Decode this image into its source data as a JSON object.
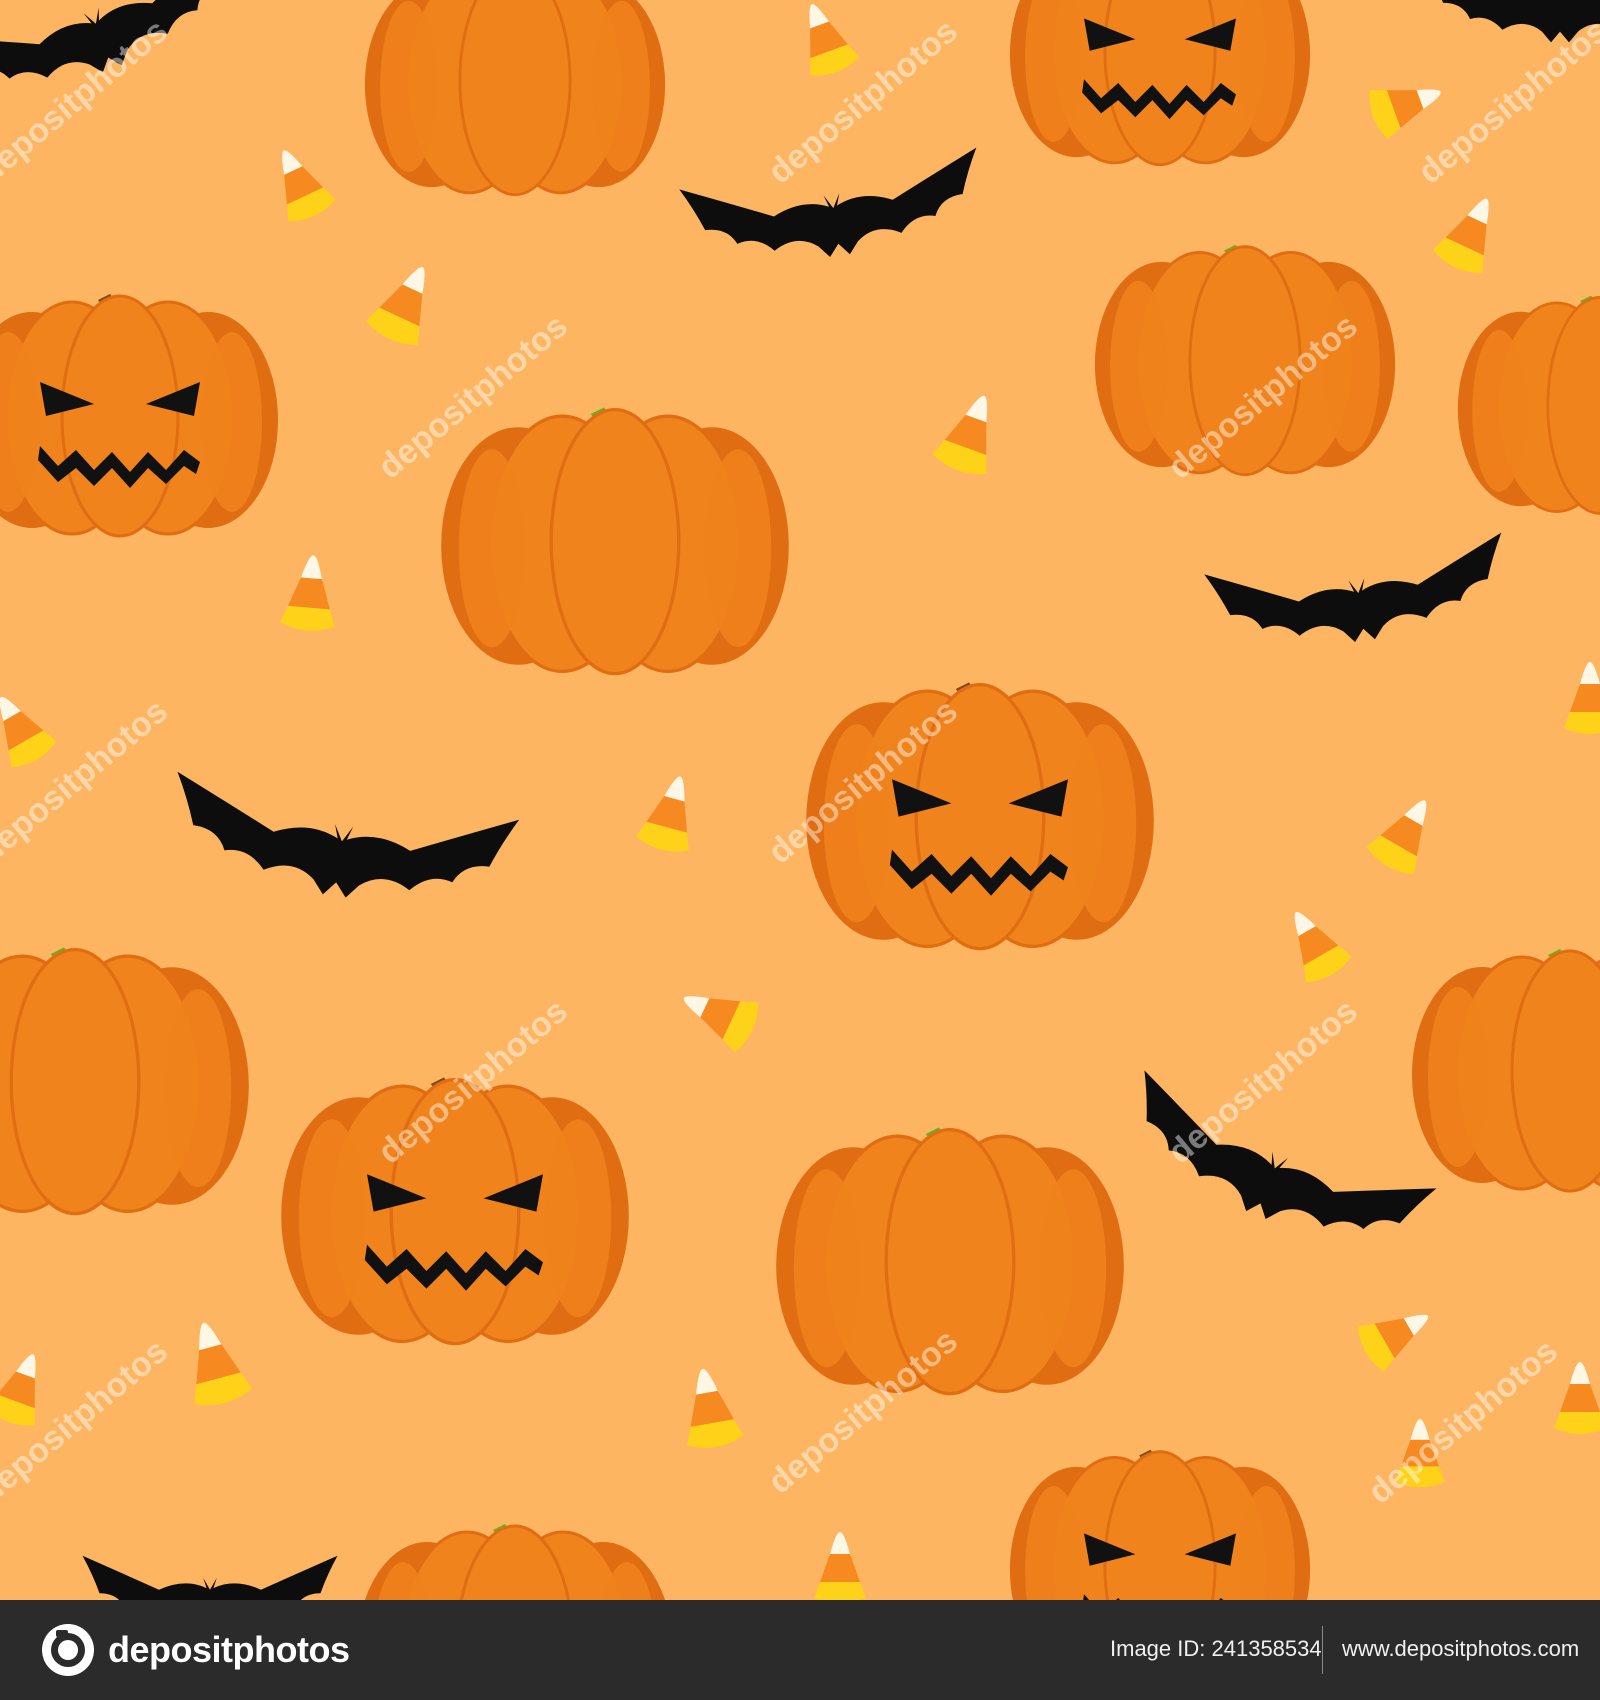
{
  "colors": {
    "background": "#fdb561",
    "pumpkin": "#f0831c",
    "pumpkin_dark": "#e06d12",
    "stem_green": "#5cb521",
    "stem_brown": "#7a4a23",
    "bat": "#0d0d0d",
    "candy_yellow": "#ffd21a",
    "candy_orange": "#f6891f",
    "candy_white": "#fff7e6",
    "footer_bg": "#2b2b2b"
  },
  "pattern": {
    "elements": [
      "pumpkin",
      "jack-o-lantern",
      "bat",
      "candy-corn"
    ],
    "watermark": "depositphotos"
  },
  "footer": {
    "brand": "depositphotos",
    "image_id_label": "Image ID:",
    "image_id": "241358534",
    "site_url": "www.depositphotos.com"
  }
}
